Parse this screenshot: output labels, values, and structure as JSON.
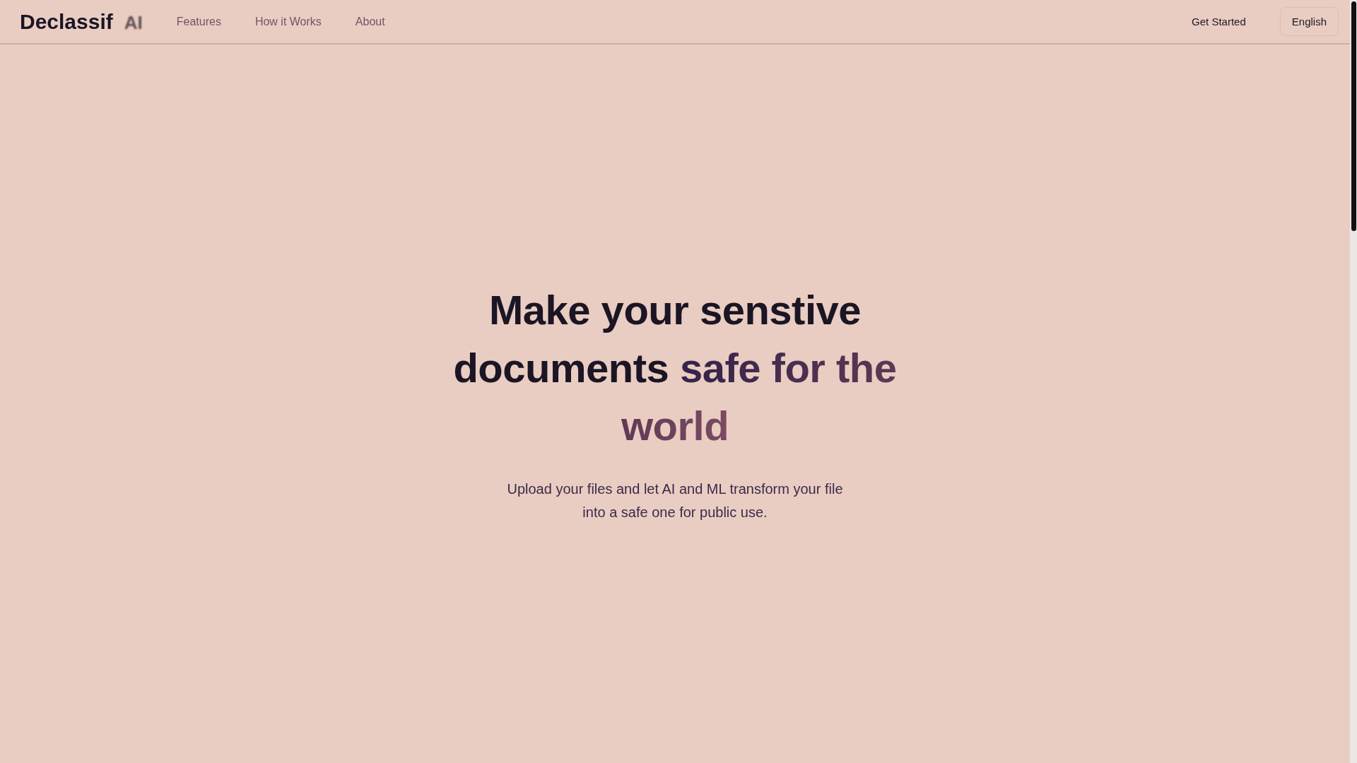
{
  "header": {
    "logo": {
      "name": "Declassif",
      "suffix": "AI"
    },
    "nav": [
      "Features",
      "How it Works",
      "About"
    ],
    "cta": "Get Started",
    "language": "English"
  },
  "hero": {
    "headline": "Make your senstive documents",
    "headline_highlight": "safe for the world",
    "subtitle": "Upload your files and let AI and ML transform your file into a safe one for public use."
  }
}
